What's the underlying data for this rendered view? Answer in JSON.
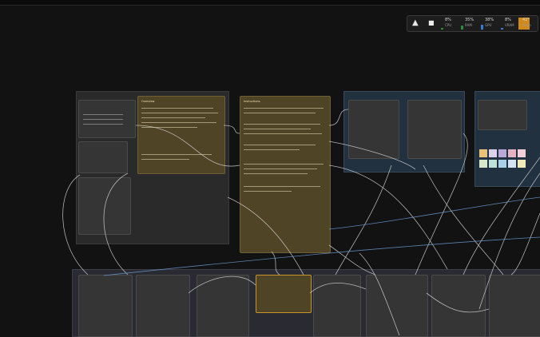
{
  "toolbar": {
    "logo_icon": "comfy-logo-icon",
    "stop_icon": "stop-icon",
    "meters": [
      {
        "value": "8%",
        "label": "CPU",
        "color": "#2e8b3a",
        "fill": 0.08
      },
      {
        "value": "35%",
        "label": "RAM",
        "color": "#2e8b3a",
        "fill": 0.35
      },
      {
        "value": "38%",
        "label": "GPU",
        "color": "#3a7bd5",
        "fill": 0.38
      },
      {
        "value": "8%",
        "label": "VRAM",
        "color": "#3a7bd5",
        "fill": 0.08
      },
      {
        "value": "42°",
        "label": "Temp",
        "color": "#d08a1c",
        "fill": 1.0
      }
    ]
  },
  "notes": {
    "left_note_title": "Overview",
    "center_note_title": "Instructions"
  },
  "colors": {
    "canvas": "#121212",
    "group_gray": "#2a2a2a",
    "group_slate": "#22313f",
    "note_yellow": "#4f4426",
    "wire": "#e3e3e3",
    "wire_blue": "#6ea0d8"
  },
  "palette_swatches": [
    "#e8c27a",
    "#d9d2ea",
    "#b9a7d9",
    "#e3b3c3",
    "#f3d0d8",
    "#d8e8c8",
    "#bfe0d8",
    "#a9d0e8",
    "#d4e3f4",
    "#f2e8b8"
  ]
}
